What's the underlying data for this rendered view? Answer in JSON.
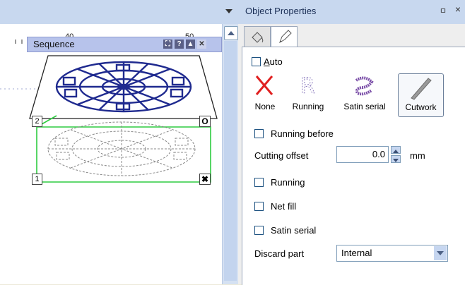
{
  "left_panel": {
    "ruler": {
      "tick_labels": [
        "40",
        "50"
      ]
    },
    "sequence_title": "Sequence",
    "layers": [
      {
        "index_label": "2",
        "action_label": "O"
      },
      {
        "index_label": "1",
        "action_label": "✖"
      }
    ]
  },
  "properties_panel": {
    "title": "Object Properties",
    "pin_glyph": "ㅁ",
    "close_glyph": "×",
    "auto_label": "Auto",
    "stitch_types": [
      {
        "label": "None",
        "icon": "red-x-icon",
        "color": "#e02020"
      },
      {
        "label": "Running",
        "icon": "running-r-icon",
        "color": "#8b7bbd"
      },
      {
        "label": "Satin serial",
        "icon": "satin-s-icon",
        "color": "#7b4fa8"
      },
      {
        "label": "Cutwork",
        "icon": "cutwork-knife-icon",
        "selected": true
      }
    ],
    "running_before_label": "Running before",
    "cutting_offset_label": "Cutting offset",
    "cutting_offset_value": "0.0",
    "cutting_offset_unit": "mm",
    "running_label": "Running",
    "net_fill_label": "Net fill",
    "satin_serial_label": "Satin serial",
    "discard_part_label": "Discard part",
    "discard_part_value": "Internal"
  }
}
